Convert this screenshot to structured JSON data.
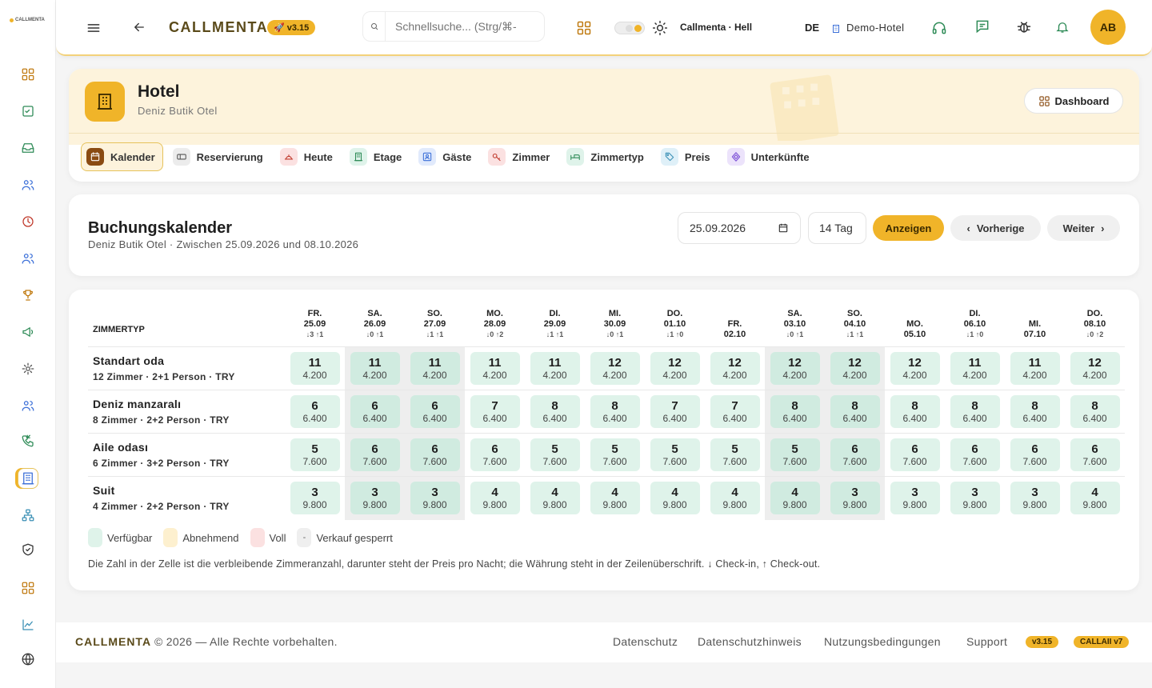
{
  "app": {
    "logo_text": "CALLMENTA",
    "brand": "CALLMENTA",
    "version": "v3.15"
  },
  "search": {
    "placeholder": "Schnellsuche... (Strg/⌘-"
  },
  "theme": {
    "label": "Callmenta · Hell"
  },
  "language": "DE",
  "hotel_select": "Demo-Hotel",
  "user_initials": "AB",
  "sidebar": [
    "dashboard",
    "checklist",
    "inbox",
    "users",
    "clock",
    "team",
    "trophy",
    "megaphone",
    "settings",
    "guests",
    "calls",
    "hotel",
    "network",
    "shield",
    "apps",
    "analytics",
    "globe"
  ],
  "hotel": {
    "title": "Hotel",
    "subtitle": "Deniz Butik Otel",
    "dashboard_label": "Dashboard"
  },
  "tabs": [
    {
      "label": "Kalender",
      "icon": "calendar-icon",
      "color": "#8a4b12",
      "bg": "#8a4b12",
      "active": true
    },
    {
      "label": "Reservierung",
      "icon": "reservation-icon",
      "color": "#555",
      "bg": "#ececec"
    },
    {
      "label": "Heute",
      "icon": "bell-service-icon",
      "color": "#c0392b",
      "bg": "#fbe1e1"
    },
    {
      "label": "Etage",
      "icon": "building-icon",
      "color": "#2e8b57",
      "bg": "#dff3ea"
    },
    {
      "label": "Gäste",
      "icon": "guest-icon",
      "color": "#3b6fd8",
      "bg": "#e1eafc"
    },
    {
      "label": "Zimmer",
      "icon": "key-icon",
      "color": "#c0392b",
      "bg": "#fbe1e1"
    },
    {
      "label": "Zimmertyp",
      "icon": "bed-icon",
      "color": "#2e8b57",
      "bg": "#dff3ea"
    },
    {
      "label": "Preis",
      "icon": "tag-icon",
      "color": "#3a8fb5",
      "bg": "#dff0f8"
    },
    {
      "label": "Unterkünfte",
      "icon": "diamond-icon",
      "color": "#7b4fd6",
      "bg": "#ece3fb"
    }
  ],
  "calendar": {
    "title": "Buchungskalender",
    "subtitle": "Deniz Butik Otel · Zwischen 25.09.2026 und 08.10.2026",
    "date_value": "25.09.2026",
    "days_value": "14 Tag",
    "show_label": "Anzeigen",
    "prev_label": "Vorherige",
    "next_label": "Weiter",
    "row_header": "ZIMMERTYP",
    "days": [
      {
        "wd": "FR.",
        "date": "25.09",
        "mv": "↓3 ↑1",
        "weekend": false
      },
      {
        "wd": "SA.",
        "date": "26.09",
        "mv": "↓0 ↑1",
        "weekend": true
      },
      {
        "wd": "SO.",
        "date": "27.09",
        "mv": "↓1 ↑1",
        "weekend": true
      },
      {
        "wd": "MO.",
        "date": "28.09",
        "mv": "↓0 ↑2",
        "weekend": false
      },
      {
        "wd": "DI.",
        "date": "29.09",
        "mv": "↓1 ↑1",
        "weekend": false
      },
      {
        "wd": "MI.",
        "date": "30.09",
        "mv": "↓0 ↑1",
        "weekend": false
      },
      {
        "wd": "DO.",
        "date": "01.10",
        "mv": "↓1 ↑0",
        "weekend": false
      },
      {
        "wd": "FR.",
        "date": "02.10",
        "mv": "",
        "weekend": false
      },
      {
        "wd": "SA.",
        "date": "03.10",
        "mv": "↓0 ↑1",
        "weekend": true
      },
      {
        "wd": "SO.",
        "date": "04.10",
        "mv": "↓1 ↑1",
        "weekend": true
      },
      {
        "wd": "MO.",
        "date": "05.10",
        "mv": "",
        "weekend": false
      },
      {
        "wd": "DI.",
        "date": "06.10",
        "mv": "↓1 ↑0",
        "weekend": false
      },
      {
        "wd": "MI.",
        "date": "07.10",
        "mv": "",
        "weekend": false
      },
      {
        "wd": "DO.",
        "date": "08.10",
        "mv": "↓0 ↑2",
        "weekend": false
      }
    ],
    "rooms": [
      {
        "name": "Standart oda",
        "meta": "12 Zimmer · 2+1 Person · TRY",
        "price": "4.200",
        "avail": [
          11,
          11,
          11,
          11,
          11,
          12,
          12,
          12,
          12,
          12,
          12,
          11,
          11,
          12
        ]
      },
      {
        "name": "Deniz manzaralı",
        "meta": "8 Zimmer · 2+2 Person · TRY",
        "price": "6.400",
        "avail": [
          6,
          6,
          6,
          7,
          8,
          8,
          7,
          7,
          8,
          8,
          8,
          8,
          8,
          8
        ]
      },
      {
        "name": "Aile odası",
        "meta": "6 Zimmer · 3+2 Person · TRY",
        "price": "7.600",
        "avail": [
          5,
          6,
          6,
          6,
          5,
          5,
          5,
          5,
          5,
          6,
          6,
          6,
          6,
          6
        ]
      },
      {
        "name": "Suit",
        "meta": "4 Zimmer · 2+2 Person · TRY",
        "price": "9.800",
        "avail": [
          3,
          3,
          3,
          4,
          4,
          4,
          4,
          4,
          4,
          3,
          3,
          3,
          3,
          4
        ]
      }
    ],
    "legend": [
      {
        "label": "Verfügbar",
        "color": "#dff3ea",
        "mark": ""
      },
      {
        "label": "Abnehmend",
        "color": "#fdf0cf",
        "mark": ""
      },
      {
        "label": "Voll",
        "color": "#fbe1e1",
        "mark": ""
      },
      {
        "label": "Verkauf gesperrt",
        "color": "#efefef",
        "mark": "-"
      }
    ],
    "note": "Die Zahl in der Zelle ist die verbleibende Zimmeranzahl, darunter steht der Preis pro Nacht; die Währung steht in der Zeilenüberschrift. ↓ Check-in, ↑ Check-out."
  },
  "footer": {
    "brand": "CALLMENTA",
    "copyright": "© 2026 — Alle Rechte vorbehalten.",
    "links": [
      "Datenschutz",
      "Datenschutzhinweis",
      "Nutzungsbedingungen",
      "Support"
    ],
    "version": "v3.15",
    "ai_version": "CALLAII v7"
  }
}
